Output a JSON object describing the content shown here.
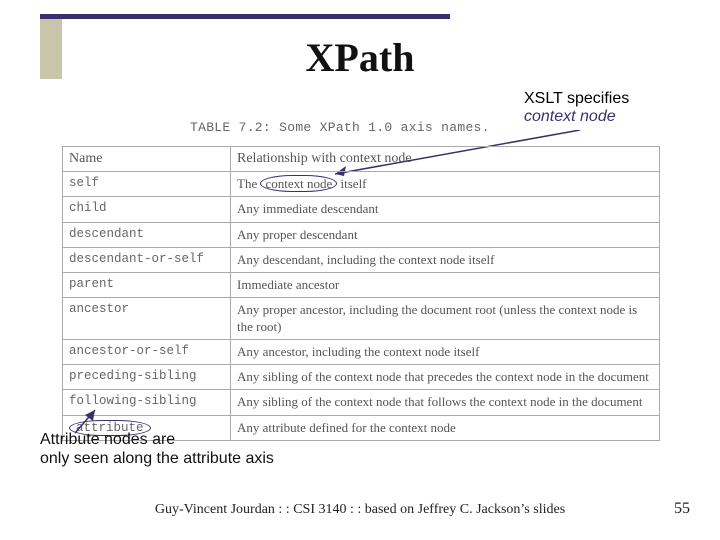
{
  "title": "XPath",
  "caption": "TABLE 7.2: Some XPath 1.0 axis names.",
  "annot_top_l1": "XSLT specifies",
  "annot_top_l2": "context node",
  "annot_bot_l1": "Attribute nodes are",
  "annot_bot_l2": "only seen along the attribute axis",
  "footer": "Guy-Vincent Jourdan : : CSI 3140 : : based on Jeffrey C. Jackson’s slides",
  "pagenum": "55",
  "table": {
    "headers": [
      "Name",
      "Relationship with context node"
    ],
    "rows": [
      {
        "name": "self",
        "rel_pre": "The ",
        "rel_oval": "context node",
        "rel_post": " itself"
      },
      {
        "name": "child",
        "rel": "Any immediate descendant"
      },
      {
        "name": "descendant",
        "rel": "Any proper descendant"
      },
      {
        "name": "descendant-or-self",
        "rel": "Any descendant, including the context node itself"
      },
      {
        "name": "parent",
        "rel": "Immediate ancestor"
      },
      {
        "name": "ancestor",
        "rel": "Any proper ancestor, including the document root (unless the context node is the root)"
      },
      {
        "name": "ancestor-or-self",
        "rel": "Any ancestor, including the context node itself"
      },
      {
        "name": "preceding-sibling",
        "rel": "Any sibling of the context node that precedes the context node in the document"
      },
      {
        "name": "following-sibling",
        "rel": "Any sibling of the context node that follows the context node in the document"
      },
      {
        "name_oval": "attribute",
        "rel": "Any attribute defined for the context node"
      }
    ]
  },
  "chart_data": {
    "type": "table",
    "title": "TABLE 7.2: Some XPath 1.0 axis names.",
    "columns": [
      "Name",
      "Relationship with context node"
    ],
    "rows": [
      [
        "self",
        "The context node itself"
      ],
      [
        "child",
        "Any immediate descendant"
      ],
      [
        "descendant",
        "Any proper descendant"
      ],
      [
        "descendant-or-self",
        "Any descendant, including the context node itself"
      ],
      [
        "parent",
        "Immediate ancestor"
      ],
      [
        "ancestor",
        "Any proper ancestor, including the document root (unless the context node is the root)"
      ],
      [
        "ancestor-or-self",
        "Any ancestor, including the context node itself"
      ],
      [
        "preceding-sibling",
        "Any sibling of the context node that precedes the context node in the document"
      ],
      [
        "following-sibling",
        "Any sibling of the context node that follows the context node in the document"
      ],
      [
        "attribute",
        "Any attribute defined for the context node"
      ]
    ]
  }
}
